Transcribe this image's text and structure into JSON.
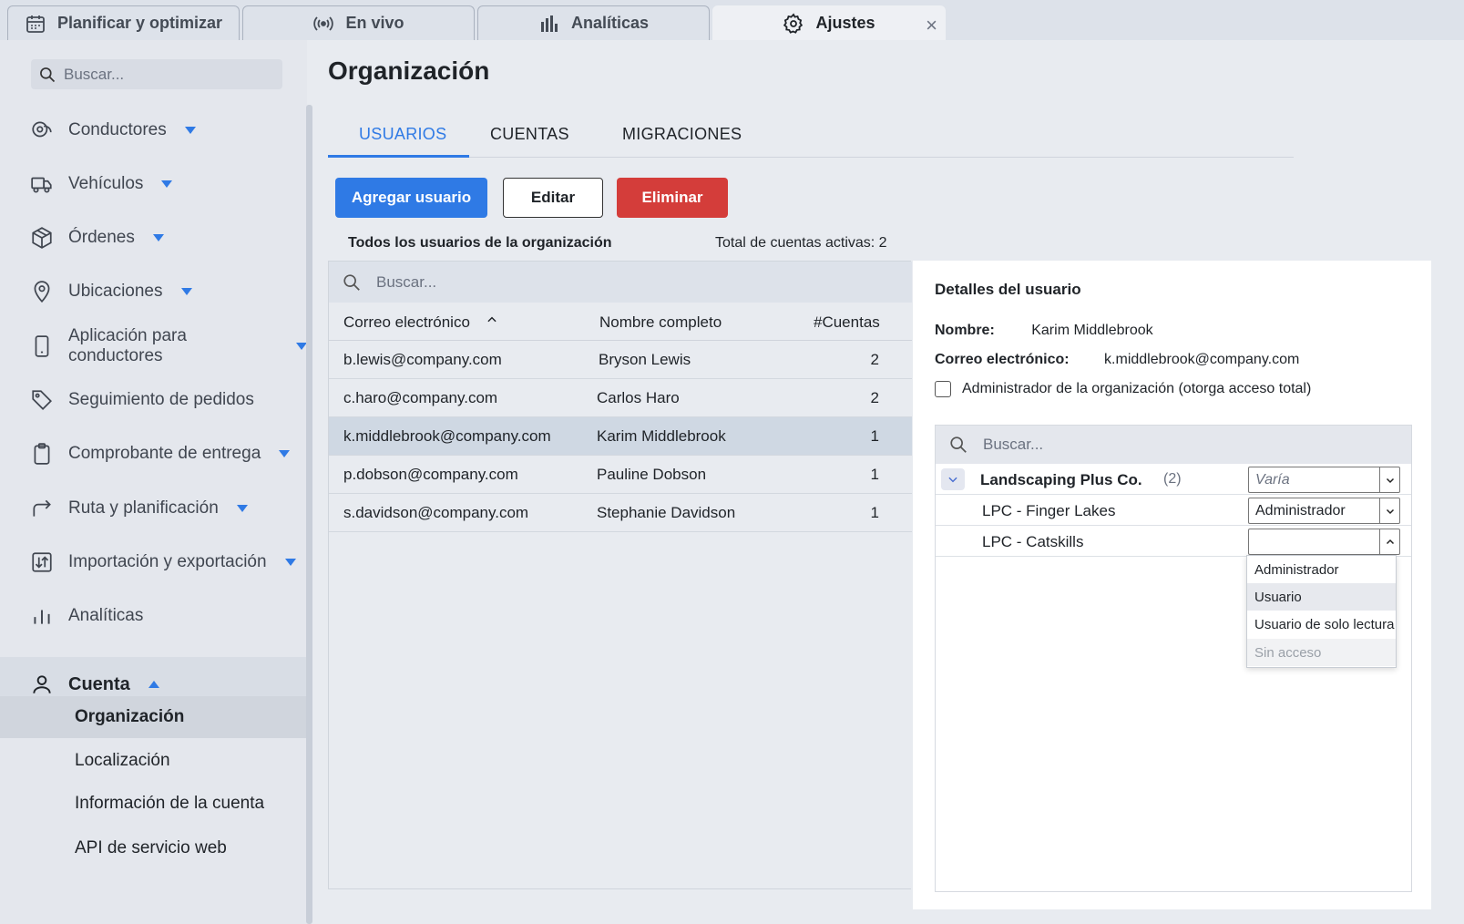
{
  "tabs": [
    {
      "label": "Planificar y optimizar",
      "icon": "calendar-icon"
    },
    {
      "label": "En vivo",
      "icon": "broadcast-icon"
    },
    {
      "label": "Analíticas",
      "icon": "bar-chart-icon"
    },
    {
      "label": "Ajustes",
      "icon": "gear-icon",
      "active": true,
      "close": "×"
    }
  ],
  "sidebar": {
    "search_placeholder": "Buscar...",
    "items": [
      {
        "label": "Conductores",
        "icon": "drivers-icon"
      },
      {
        "label": "Vehículos",
        "icon": "truck-icon"
      },
      {
        "label": "Órdenes",
        "icon": "package-icon"
      },
      {
        "label": "Ubicaciones",
        "icon": "location-pin-icon"
      },
      {
        "label": "Aplicación para conductores",
        "icon": "phone-icon"
      },
      {
        "label": "Seguimiento de pedidos",
        "icon": "tag-icon"
      },
      {
        "label": "Comprobante de entrega",
        "icon": "clipboard-icon"
      },
      {
        "label": "Ruta y planificación",
        "icon": "route-arrow-icon"
      },
      {
        "label": "Importación y exportación",
        "icon": "import-export-icon"
      },
      {
        "label": "Analíticas",
        "icon": "analytics-icon"
      }
    ],
    "account": {
      "label": "Cuenta",
      "icon": "user-icon",
      "subitems": [
        "Organización",
        "Localización",
        "Información de la cuenta",
        "API de servicio web"
      ]
    }
  },
  "main": {
    "title": "Organización",
    "subtabs": [
      "USUARIOS",
      "CUENTAS",
      "MIGRACIONES"
    ],
    "buttons": {
      "add": "Agregar usuario",
      "edit": "Editar",
      "delete": "Eliminar"
    },
    "list_label": "Todos los usuarios de la organización",
    "active_total": "Total de cuentas activas: 2",
    "table": {
      "search_placeholder": "Buscar...",
      "headers": [
        "Correo electrónico",
        "Nombre completo",
        "#Cuentas"
      ],
      "rows": [
        {
          "email": "b.lewis@company.com",
          "name": "Bryson Lewis",
          "accounts": "2"
        },
        {
          "email": "c.haro@company.com",
          "name": "Carlos Haro",
          "accounts": "2"
        },
        {
          "email": "k.middlebrook@company.com",
          "name": "Karim Middlebrook",
          "accounts": "1",
          "selected": true
        },
        {
          "email": "p.dobson@company.com",
          "name": "Pauline Dobson",
          "accounts": "1"
        },
        {
          "email": "s.davidson@company.com",
          "name": "Stephanie Davidson",
          "accounts": "1"
        }
      ]
    }
  },
  "details": {
    "title": "Detalles del usuario",
    "name_label": "Nombre:",
    "name_value": "Karim Middlebrook",
    "email_label": "Correo electrónico:",
    "email_value": "k.middlebrook@company.com",
    "admin_checkbox": "Administrador de la organización (otorga acceso total)",
    "search_placeholder": "Buscar...",
    "accounts": [
      {
        "name": "Landscaping Plus Co.",
        "count": "(2)",
        "role": "Varía"
      },
      {
        "name": "LPC - Finger Lakes",
        "role": "Administrador"
      },
      {
        "name": "LPC - Catskills",
        "role": ""
      }
    ],
    "dropdown_options": [
      "Administrador",
      "Usuario",
      "Usuario de solo lectura",
      "Sin acceso"
    ]
  },
  "colors": {
    "accent": "#2f7ae5",
    "danger": "#d43d3a",
    "selected_row": "#cfd8e3"
  }
}
